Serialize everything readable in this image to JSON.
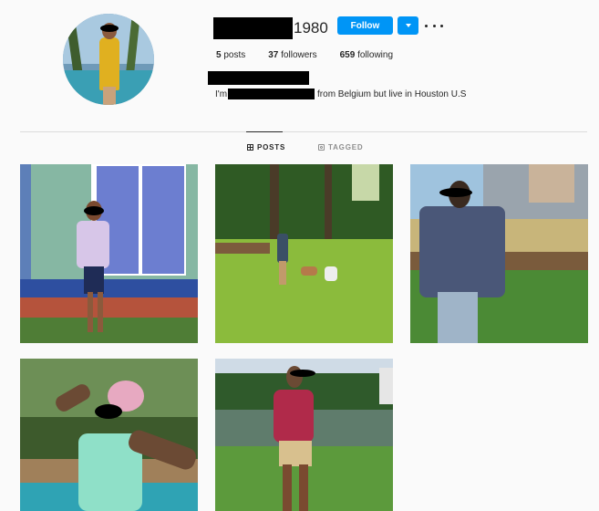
{
  "profile": {
    "username_suffix": "1980",
    "follow_label": "Follow",
    "stats": [
      {
        "count": "5",
        "label": "posts"
      },
      {
        "count": "37",
        "label": "followers"
      },
      {
        "count": "659",
        "label": "following"
      }
    ],
    "bio_prefix": "I'm",
    "bio_suffix": "from Belgium but live in Houston U.S"
  },
  "tabs": {
    "posts": "POSTS",
    "tagged": "TAGGED"
  },
  "colors": {
    "follow_blue": "#0095f6",
    "background": "#fafafa",
    "divider": "#dbdbdb",
    "muted_text": "#8e8e8e"
  },
  "icons": [
    "dropdown-caret-icon",
    "more-options-icon",
    "grid-icon",
    "tagged-icon"
  ]
}
